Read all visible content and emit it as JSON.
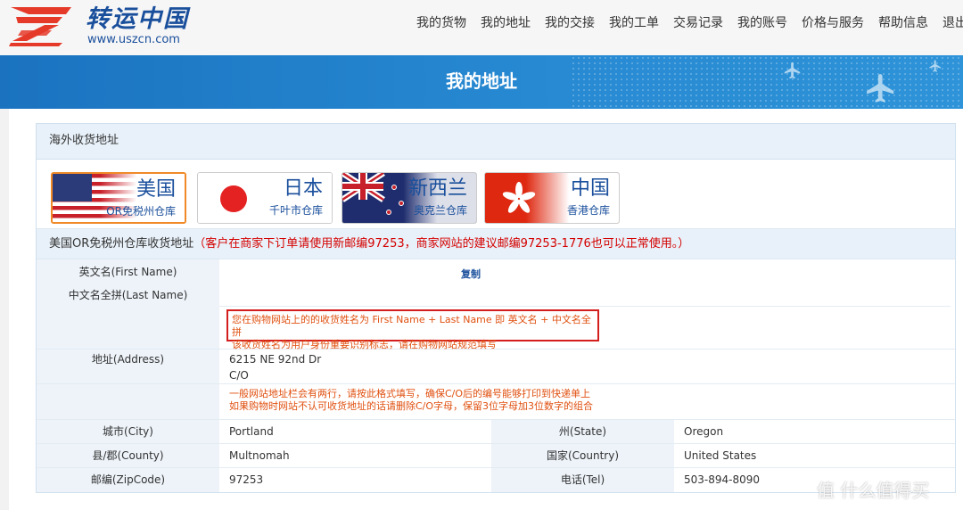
{
  "site": {
    "logo_text": "转运中国",
    "logo_url": "www.uszcn.com",
    "nav": [
      "我的货物",
      "我的地址",
      "我的交接",
      "我的工单",
      "交易记录",
      "我的账号",
      "价格与服务",
      "帮助信息",
      "退出登"
    ]
  },
  "banner": {
    "title": "我的地址"
  },
  "overseas": {
    "title": "海外收货地址",
    "countries": [
      {
        "name": "美国",
        "sub": "OR免税州仓库",
        "active": true
      },
      {
        "name": "日本",
        "sub": "千叶市仓库",
        "active": false
      },
      {
        "name": "新西兰",
        "sub": "奥克兰仓库",
        "active": false
      },
      {
        "name": "中国",
        "sub": "香港仓库",
        "active": false
      }
    ]
  },
  "address": {
    "title": "美国OR免税州仓库收货地址",
    "note": "（客户在商家下订单请使用新邮编97253，商家网站的建议邮编97253-1776也可以正常使用。）",
    "first_name_label": "英文名(First Name)",
    "last_name_label": "中文名全拼(Last Name)",
    "copy_label": "复制",
    "name_tip_1": "您在购物网站上的的收货姓名为 First Name + Last Name 即 英文名 + 中文名全拼",
    "name_tip_2": "该收货姓名为用户身份重要识别标志，请在购物网站规范填写",
    "address_label": "地址(Address)",
    "address_line1": "6215 NE 92nd Dr",
    "address_line2": "C/O",
    "address_tip_1": "一般网站地址栏会有两行，请按此格式填写，确保C/O后的编号能够打印到快递单上",
    "address_tip_2": "如果购物时网站不认可收货地址的话请删除C/O字母，保留3位字母加3位数字的组合",
    "city_label": "城市(City)",
    "city": "Portland",
    "state_label": "州(State)",
    "state": "Oregon",
    "county_label": "县/郡(County)",
    "county": "Multnomah",
    "country_label": "国家(Country)",
    "country": "United States",
    "zip_label": "邮编(ZipCode)",
    "zip": "97253",
    "phone_label": "电话(Tel)",
    "phone": "503-894-8090"
  },
  "watermark": "值 什么值得买",
  "colors": {
    "brand_blue": "#1a4f9c",
    "banner_blue": "#2789d2",
    "active_orange": "#f08a28",
    "note_red": "#d40000"
  }
}
